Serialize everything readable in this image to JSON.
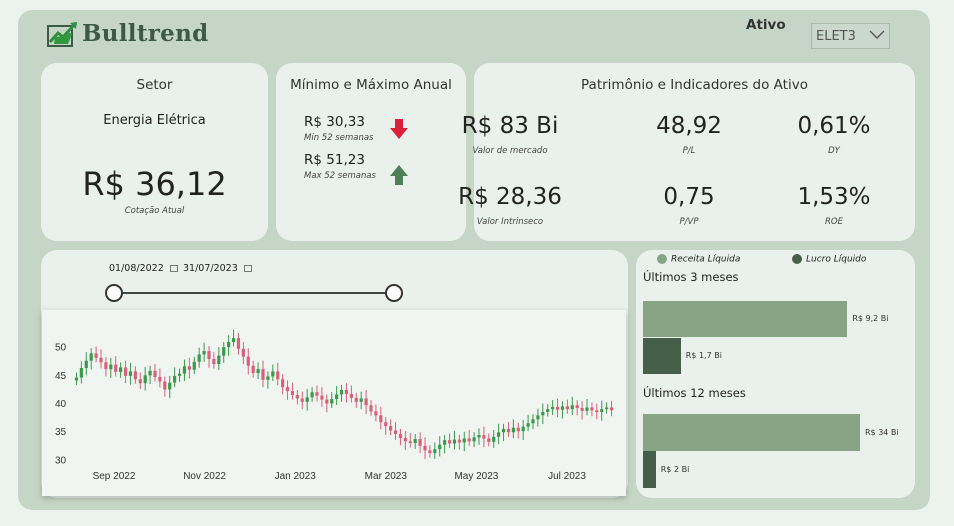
{
  "app": {
    "logo_text": "Bulltrend",
    "ativo_label": "Ativo",
    "ativo_value": "ELET3"
  },
  "setor": {
    "title": "Setor",
    "value": "Energia Elétrica",
    "price": "R$ 36,12",
    "price_caption": "Cotação Atual"
  },
  "minmax": {
    "title": "Mínimo e Máximo Anual",
    "min_value": "R$ 30,33",
    "min_caption": "Min 52 semanas",
    "max_value": "R$ 51,23",
    "max_caption": "Max 52 semanas",
    "down_color": "#d9223a",
    "up_color": "#4f7f57"
  },
  "indicators": {
    "title": "Patrimônio e Indicadores do Ativo",
    "items": [
      {
        "value": "R$ 83 Bi",
        "caption": "Valor de mercado"
      },
      {
        "value": "48,92",
        "caption": "P/L"
      },
      {
        "value": "0,61%",
        "caption": "DY"
      },
      {
        "value": "R$ 28,36",
        "caption": "Valor Intrinseco"
      },
      {
        "value": "0,75",
        "caption": "P/VP"
      },
      {
        "value": "1,53%",
        "caption": "ROE"
      }
    ]
  },
  "date_filter": {
    "start": "01/08/2022",
    "end": "31/07/2023",
    "start_fraction": 0,
    "end_fraction": 1
  },
  "chart_data": [
    {
      "type": "candlestick",
      "x_ticks": [
        "Sep 2022",
        "Nov 2022",
        "Jan 2023",
        "Mar 2023",
        "May 2023",
        "Jul 2023"
      ],
      "y_ticks": [
        30,
        35,
        40,
        45,
        50
      ],
      "ylim": [
        29,
        54
      ],
      "up_color": "#3a9a4a",
      "down_color": "#d9607a",
      "closes": [
        44.5,
        46.2,
        47.5,
        48.8,
        48.0,
        47.2,
        46.0,
        46.8,
        45.5,
        46.3,
        44.8,
        45.6,
        44.2,
        43.5,
        44.9,
        45.7,
        44.6,
        43.8,
        42.4,
        43.6,
        44.8,
        45.2,
        46.5,
        45.9,
        47.3,
        48.6,
        49.2,
        47.8,
        46.9,
        48.4,
        49.9,
        50.8,
        51.5,
        49.6,
        48.2,
        46.6,
        45.3,
        46.0,
        44.1,
        44.7,
        45.6,
        44.2,
        42.8,
        42.1,
        41.4,
        40.8,
        40.2,
        41.0,
        41.9,
        41.3,
        40.6,
        39.9,
        40.7,
        41.5,
        42.3,
        41.6,
        40.9,
        40.2,
        40.8,
        39.6,
        38.5,
        37.8,
        36.6,
        35.9,
        35.1,
        34.5,
        33.8,
        33.2,
        32.9,
        33.6,
        32.4,
        31.6,
        31.1,
        31.8,
        32.6,
        33.4,
        32.8,
        33.5,
        33.0,
        33.7,
        33.2,
        33.9,
        34.3,
        33.7,
        33.1,
        34.0,
        34.8,
        35.4,
        34.8,
        35.6,
        35.0,
        35.8,
        36.4,
        37.1,
        37.8,
        38.4,
        38.9,
        39.3,
        38.8,
        39.4,
        38.9,
        39.6,
        39.1,
        38.6,
        39.2,
        38.7,
        38.4,
        38.9,
        39.2,
        38.7
      ]
    },
    {
      "type": "bar",
      "orientation": "horizontal",
      "legend_position": "top",
      "series_names": [
        "Receita Líquida",
        "Lucro Líquido"
      ],
      "series_colors": [
        "#87a485",
        "#455f48"
      ],
      "groups": [
        {
          "title": "Últimos 3 meses",
          "values": [
            9.2,
            1.7
          ],
          "labels": [
            "R$ 9,2 Bi",
            "R$ 1,7 Bi"
          ]
        },
        {
          "title": "Últimos 12 meses",
          "values": [
            34,
            2
          ],
          "labels": [
            "R$ 34 Bi",
            "R$ 2 Bi"
          ]
        }
      ]
    }
  ]
}
